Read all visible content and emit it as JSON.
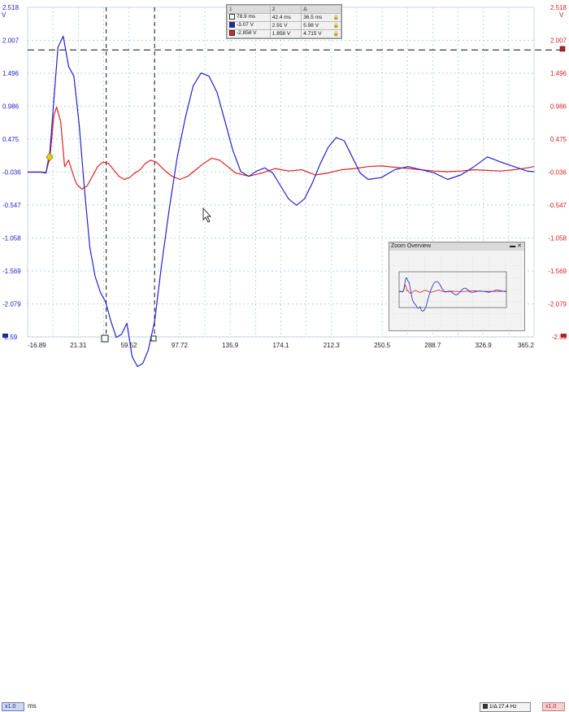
{
  "colors": {
    "blue": "#2222cc",
    "red": "#dd2222",
    "grid": "#9fc3d8",
    "background": "#ffffff"
  },
  "axes": {
    "left_labels": [
      "2.518",
      "2.007",
      "1.496",
      "0.986",
      "0.475",
      "-0.036",
      "-0.547",
      "-1.058",
      "-1.569",
      "-2.079",
      "-2.59"
    ],
    "right_labels": [
      "2.518",
      "2.007",
      "1.496",
      "0.986",
      "0.475",
      "-0.036",
      "-0.547",
      "-1.058",
      "-1.569",
      "-2.079",
      "-2.59"
    ],
    "left_unit": "V",
    "right_unit": "V",
    "x_labels": [
      "-16.89",
      "21.31",
      "59.52",
      "97.72",
      "135.9",
      "174.1",
      "212.3",
      "250.5",
      "288.7",
      "326.9",
      "365.2"
    ],
    "x_unit": "ms"
  },
  "cursor_table": {
    "header": [
      "1",
      "2",
      "Δ"
    ],
    "rows": [
      {
        "values": [
          "78.9 ms",
          "42.4 ms",
          "36.5 ms"
        ]
      },
      {
        "values": [
          "-3.07 V",
          "2.91 V",
          "5.98 V"
        ]
      },
      {
        "values": [
          "-2.858 V",
          "1.858 V",
          "4.715 V"
        ]
      }
    ]
  },
  "zoom_overview": {
    "title": "Zoom Overview"
  },
  "status": {
    "left_multiplier": "x1.0",
    "x_unit": "ms",
    "right_multiplier": "x1.0",
    "freq_prefix": "1/Δ",
    "frequency": "27.4 Hz"
  },
  "chart_data": {
    "type": "line",
    "x_unit": "ms",
    "y_unit": "V",
    "xlim": [
      -16.89,
      365.2
    ],
    "ylim": [
      -2.59,
      2.518
    ],
    "grid": true,
    "cursors": {
      "vertical": [
        78.9,
        42.4
      ],
      "horizontal": [
        1.858
      ]
    },
    "series": [
      {
        "color": "#2222cc",
        "x": [
          -16.9,
          -7.0,
          -3.0,
          0.0,
          3.0,
          6.0,
          10.0,
          14.0,
          18.0,
          22.0,
          26.0,
          30.0,
          34.0,
          38.0,
          42.0,
          46.0,
          50.0,
          54.0,
          58.0,
          62.0,
          66.0,
          70.0,
          74.0,
          78.9,
          84.0,
          90.0,
          96.0,
          102.0,
          108.0,
          114.0,
          120.0,
          126.0,
          132.0,
          138.0,
          144.0,
          150.0,
          156.0,
          162.0,
          168.0,
          174.0,
          180.0,
          186.0,
          192.0,
          198.0,
          204.0,
          210.0,
          216.0,
          222.0,
          228.0,
          234.0,
          240.0,
          250.0,
          260.0,
          270.0,
          280.0,
          290.0,
          300.0,
          310.0,
          320.0,
          330.0,
          340.0,
          350.0,
          360.0,
          365.2
        ],
        "y": [
          -0.036,
          -0.036,
          -0.05,
          0.3,
          1.1,
          1.9,
          2.07,
          1.6,
          1.45,
          0.7,
          -0.3,
          -1.2,
          -1.65,
          -1.9,
          -2.05,
          -2.35,
          -2.6,
          -2.55,
          -2.38,
          -2.9,
          -3.05,
          -3.0,
          -2.8,
          -2.35,
          -1.5,
          -0.6,
          0.2,
          0.8,
          1.3,
          1.5,
          1.45,
          1.2,
          0.75,
          0.3,
          -0.03,
          -0.1,
          -0.02,
          0.03,
          -0.05,
          -0.25,
          -0.45,
          -0.55,
          -0.45,
          -0.2,
          0.1,
          0.35,
          0.5,
          0.45,
          0.2,
          -0.05,
          -0.15,
          -0.12,
          0.0,
          0.05,
          0.0,
          -0.05,
          -0.15,
          -0.08,
          0.05,
          0.2,
          0.12,
          0.05,
          -0.02,
          -0.03
        ]
      },
      {
        "color": "#dd2222",
        "x": [
          -16.9,
          -7.0,
          -3.0,
          0.0,
          3.0,
          5.0,
          8.0,
          11.0,
          14.0,
          17.0,
          20.0,
          24.0,
          28.0,
          32.0,
          36.0,
          40.0,
          44.0,
          48.0,
          52.0,
          56.0,
          60.0,
          64.0,
          68.0,
          72.0,
          76.0,
          80.0,
          86.0,
          92.0,
          98.0,
          104.0,
          110.0,
          116.0,
          122.0,
          128.0,
          134.0,
          140.0,
          150.0,
          160.0,
          170.0,
          180.0,
          190.0,
          200.0,
          210.0,
          220.0,
          230.0,
          240.0,
          250.0,
          260.0,
          270.0,
          280.0,
          290.0,
          300.0,
          310.0,
          320.0,
          330.0,
          340.0,
          350.0,
          360.0,
          365.2
        ],
        "y": [
          -0.036,
          -0.036,
          -0.04,
          0.2,
          0.85,
          0.97,
          0.75,
          0.05,
          0.15,
          -0.05,
          -0.22,
          -0.3,
          -0.25,
          -0.1,
          0.05,
          0.12,
          0.1,
          0.0,
          -0.1,
          -0.15,
          -0.12,
          -0.05,
          0.0,
          0.1,
          0.15,
          0.12,
          0.0,
          -0.1,
          -0.15,
          -0.1,
          0.0,
          0.1,
          0.18,
          0.15,
          0.05,
          -0.05,
          -0.1,
          -0.05,
          0.02,
          -0.02,
          0.0,
          -0.08,
          -0.05,
          0.0,
          0.02,
          0.05,
          0.06,
          0.04,
          0.02,
          0.0,
          -0.02,
          -0.03,
          -0.02,
          0.0,
          -0.01,
          -0.02,
          0.0,
          0.03,
          0.05
        ]
      }
    ]
  }
}
